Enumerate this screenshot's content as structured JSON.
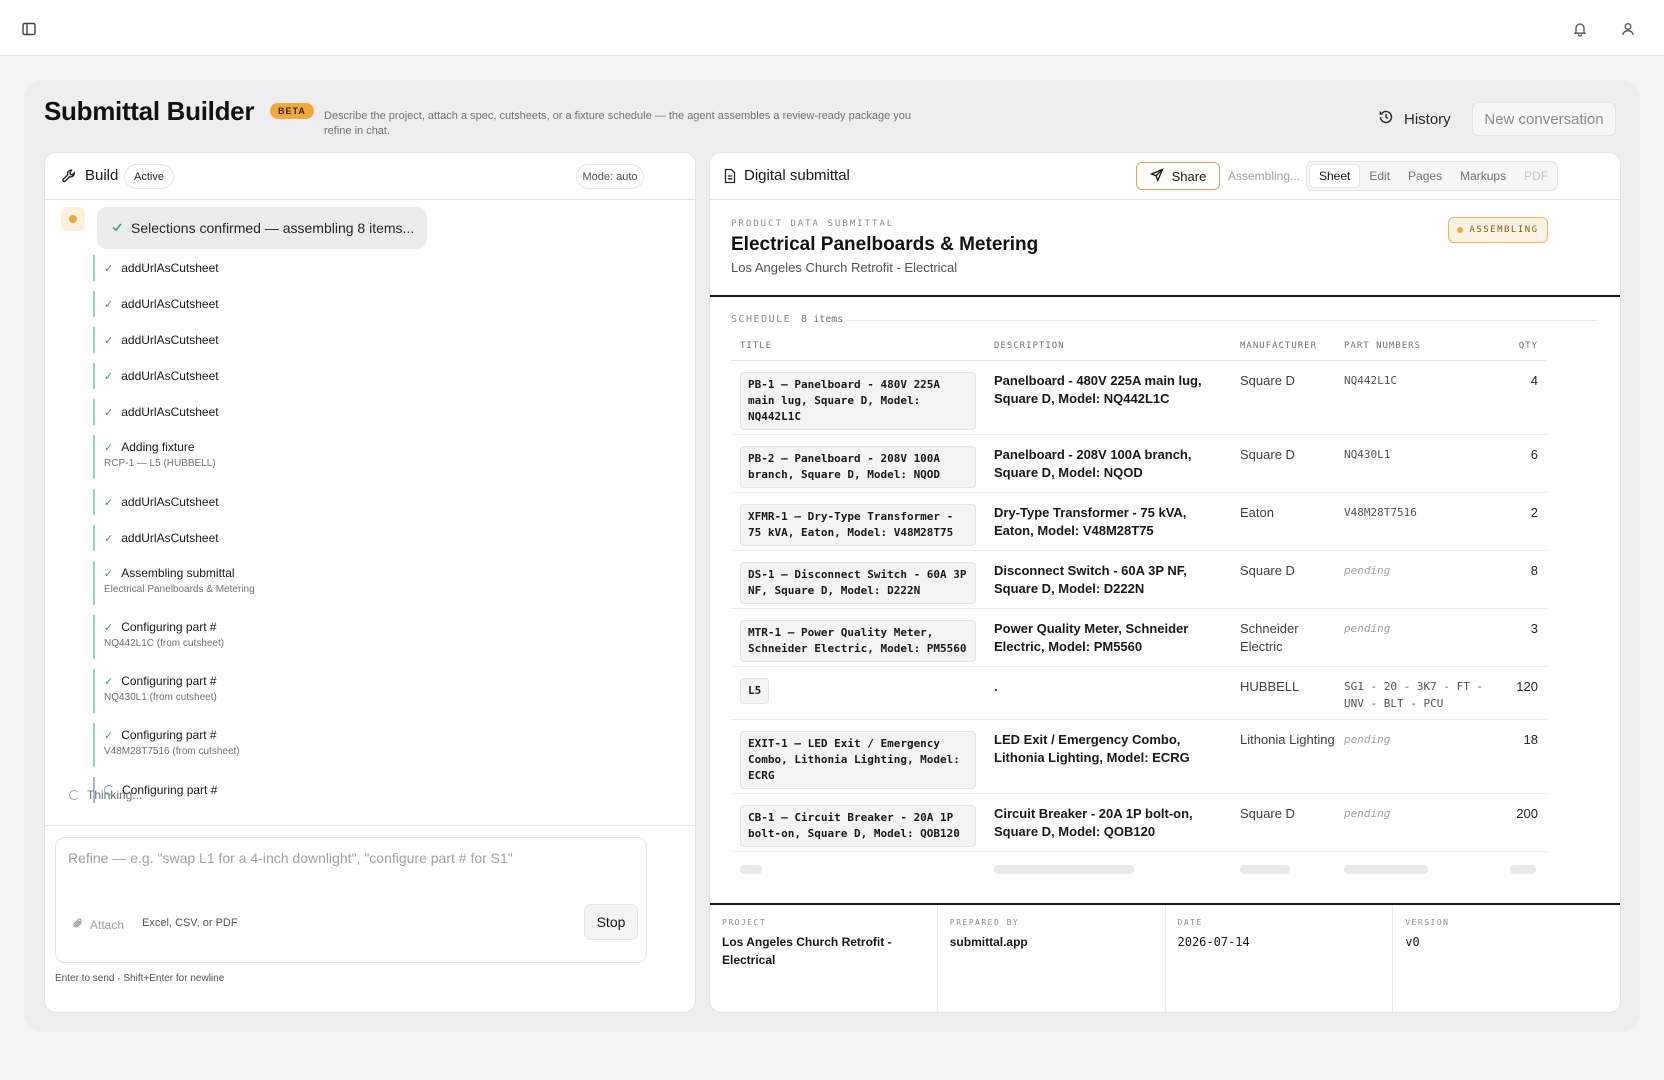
{
  "topbar": {
    "icons": [
      "sidebar-toggle-icon",
      "bell-icon",
      "user-icon"
    ]
  },
  "header": {
    "title": "Submittal Builder",
    "badge": "BETA",
    "subtitle": "Describe the project, attach a spec, cutsheets, or a fixture schedule — the agent assembles a review-ready package you refine in chat.",
    "history_label": "History",
    "new_conversation_label": "New conversation"
  },
  "build": {
    "title": "Build",
    "status": "Active",
    "mode": "Mode: auto",
    "agent_message": "Selections confirmed — assembling 8 items...",
    "steps": [
      {
        "label": "addUrlAsCutsheet",
        "detail": "",
        "state": "done"
      },
      {
        "label": "addUrlAsCutsheet",
        "detail": "",
        "state": "done"
      },
      {
        "label": "addUrlAsCutsheet",
        "detail": "",
        "state": "done"
      },
      {
        "label": "addUrlAsCutsheet",
        "detail": "",
        "state": "done"
      },
      {
        "label": "addUrlAsCutsheet",
        "detail": "",
        "state": "done"
      },
      {
        "label": "Adding fixture",
        "detail": "RCP-1 — L5 (HUBBELL)",
        "state": "done"
      },
      {
        "label": "addUrlAsCutsheet",
        "detail": "",
        "state": "done"
      },
      {
        "label": "addUrlAsCutsheet",
        "detail": "",
        "state": "done"
      },
      {
        "label": "Assembling submittal",
        "detail": "Electrical Panelboards & Metering",
        "state": "done"
      },
      {
        "label": "Configuring part #",
        "detail": "NQ442L1C (from cutsheet)",
        "state": "done"
      },
      {
        "label": "Configuring part #",
        "detail": "NQ430L1 (from cutsheet)",
        "state": "done"
      },
      {
        "label": "Configuring part #",
        "detail": "V48M28T7516 (from cutsheet)",
        "state": "done"
      },
      {
        "label": "Configuring part #",
        "detail": "",
        "state": "pending"
      }
    ],
    "thinking": "Thinking...",
    "composer": {
      "placeholder": "Refine — e.g. \"swap L1 for a 4-inch downlight\", \"configure part # for S1\"",
      "attach_label": "Attach",
      "attach_hint": "Excel, CSV, or PDF",
      "stop_label": "Stop",
      "enter_hint": "Enter to send · Shift+Enter for newline"
    }
  },
  "submittal": {
    "panel_title": "Digital submittal",
    "share_label": "Share",
    "assembling_text": "Assembling...",
    "tabs": [
      {
        "label": "Sheet",
        "state": "active"
      },
      {
        "label": "Edit",
        "state": "normal"
      },
      {
        "label": "Pages",
        "state": "normal"
      },
      {
        "label": "Markups",
        "state": "normal"
      },
      {
        "label": "PDF",
        "state": "disabled"
      }
    ],
    "eyebrow": "PRODUCT DATA SUBMITTAL",
    "doc_title": "Electrical Panelboards & Metering",
    "doc_subtitle": "Los Angeles Church Retrofit - Electrical",
    "status": "ASSEMBLING",
    "schedule_label": "SCHEDULE",
    "schedule_count": "8 items",
    "columns": {
      "title": "TITLE",
      "description": "DESCRIPTION",
      "manufacturer": "MANUFACTURER",
      "part_numbers": "PART NUMBERS",
      "qty": "QTY"
    },
    "rows": [
      {
        "title": "PB-1 — Panelboard - 480V 225A main lug, Square D, Model: NQ442L1C",
        "description": "Panelboard - 480V 225A main lug, Square D, Model: NQ442L1C",
        "manufacturer": "Square D",
        "part": "NQ442L1C",
        "pending": false,
        "qty": "4"
      },
      {
        "title": "PB-2 — Panelboard - 208V 100A branch, Square D, Model: NQOD",
        "description": "Panelboard - 208V 100A branch, Square D, Model: NQOD",
        "manufacturer": "Square D",
        "part": "NQ430L1",
        "pending": false,
        "qty": "6"
      },
      {
        "title": "XFMR-1 — Dry-Type Transformer - 75 kVA, Eaton, Model: V48M28T75",
        "description": "Dry-Type Transformer - 75 kVA, Eaton, Model: V48M28T75",
        "manufacturer": "Eaton",
        "part": "V48M28T7516",
        "pending": false,
        "qty": "2"
      },
      {
        "title": "DS-1 — Disconnect Switch - 60A 3P NF, Square D, Model: D222N",
        "description": "Disconnect Switch - 60A 3P NF, Square D, Model: D222N",
        "manufacturer": "Square D",
        "part": "pending",
        "pending": true,
        "qty": "8"
      },
      {
        "title": "MTR-1 — Power Quality Meter, Schneider Electric, Model: PM5560",
        "description": "Power Quality Meter, Schneider Electric, Model: PM5560",
        "manufacturer": "Schneider Electric",
        "part": "pending",
        "pending": true,
        "qty": "3"
      },
      {
        "title": "L5",
        "description": ".",
        "manufacturer": "HUBBELL",
        "part": "SG1 - 20 - 3K7 - FT - UNV - BLT - PCU",
        "pending": false,
        "qty": "120"
      },
      {
        "title": "EXIT-1 — LED Exit / Emergency Combo, Lithonia Lighting, Model: ECRG",
        "description": "LED Exit / Emergency Combo, Lithonia Lighting, Model: ECRG",
        "manufacturer": "Lithonia Lighting",
        "part": "pending",
        "pending": true,
        "qty": "18"
      },
      {
        "title": "CB-1 — Circuit Breaker - 20A 1P bolt-on, Square D, Model: QOB120",
        "description": "Circuit Breaker - 20A 1P bolt-on, Square D, Model: QOB120",
        "manufacturer": "Square D",
        "part": "pending",
        "pending": true,
        "qty": "200"
      }
    ],
    "footer": {
      "project_label": "PROJECT",
      "project": "Los Angeles Church Retrofit - Electrical",
      "prepared_by_label": "PREPARED BY",
      "prepared_by": "submittal.app",
      "date_label": "DATE",
      "date": "2026-07-14",
      "version_label": "VERSION",
      "version": "v0"
    }
  },
  "colors": {
    "accent": "#f2a93b",
    "step_done": "#8fd5b6",
    "step_pending": "#a9b4d6"
  }
}
